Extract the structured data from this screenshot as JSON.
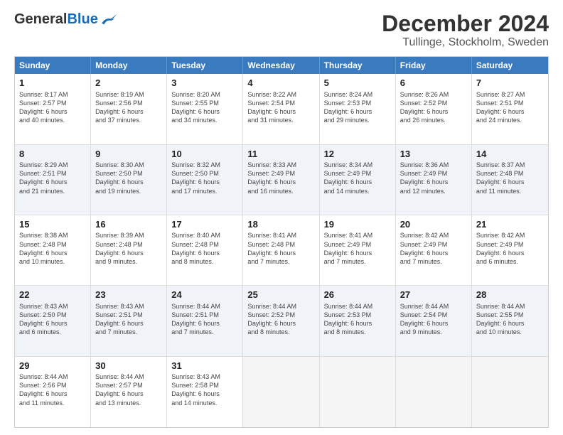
{
  "header": {
    "logo_general": "General",
    "logo_blue": "Blue",
    "title": "December 2024",
    "subtitle": "Tullinge, Stockholm, Sweden"
  },
  "weekdays": [
    "Sunday",
    "Monday",
    "Tuesday",
    "Wednesday",
    "Thursday",
    "Friday",
    "Saturday"
  ],
  "weeks": [
    [
      {
        "day": "1",
        "text": "Sunrise: 8:17 AM\nSunset: 2:57 PM\nDaylight: 6 hours\nand 40 minutes."
      },
      {
        "day": "2",
        "text": "Sunrise: 8:19 AM\nSunset: 2:56 PM\nDaylight: 6 hours\nand 37 minutes."
      },
      {
        "day": "3",
        "text": "Sunrise: 8:20 AM\nSunset: 2:55 PM\nDaylight: 6 hours\nand 34 minutes."
      },
      {
        "day": "4",
        "text": "Sunrise: 8:22 AM\nSunset: 2:54 PM\nDaylight: 6 hours\nand 31 minutes."
      },
      {
        "day": "5",
        "text": "Sunrise: 8:24 AM\nSunset: 2:53 PM\nDaylight: 6 hours\nand 29 minutes."
      },
      {
        "day": "6",
        "text": "Sunrise: 8:26 AM\nSunset: 2:52 PM\nDaylight: 6 hours\nand 26 minutes."
      },
      {
        "day": "7",
        "text": "Sunrise: 8:27 AM\nSunset: 2:51 PM\nDaylight: 6 hours\nand 24 minutes."
      }
    ],
    [
      {
        "day": "8",
        "text": "Sunrise: 8:29 AM\nSunset: 2:51 PM\nDaylight: 6 hours\nand 21 minutes."
      },
      {
        "day": "9",
        "text": "Sunrise: 8:30 AM\nSunset: 2:50 PM\nDaylight: 6 hours\nand 19 minutes."
      },
      {
        "day": "10",
        "text": "Sunrise: 8:32 AM\nSunset: 2:50 PM\nDaylight: 6 hours\nand 17 minutes."
      },
      {
        "day": "11",
        "text": "Sunrise: 8:33 AM\nSunset: 2:49 PM\nDaylight: 6 hours\nand 16 minutes."
      },
      {
        "day": "12",
        "text": "Sunrise: 8:34 AM\nSunset: 2:49 PM\nDaylight: 6 hours\nand 14 minutes."
      },
      {
        "day": "13",
        "text": "Sunrise: 8:36 AM\nSunset: 2:49 PM\nDaylight: 6 hours\nand 12 minutes."
      },
      {
        "day": "14",
        "text": "Sunrise: 8:37 AM\nSunset: 2:48 PM\nDaylight: 6 hours\nand 11 minutes."
      }
    ],
    [
      {
        "day": "15",
        "text": "Sunrise: 8:38 AM\nSunset: 2:48 PM\nDaylight: 6 hours\nand 10 minutes."
      },
      {
        "day": "16",
        "text": "Sunrise: 8:39 AM\nSunset: 2:48 PM\nDaylight: 6 hours\nand 9 minutes."
      },
      {
        "day": "17",
        "text": "Sunrise: 8:40 AM\nSunset: 2:48 PM\nDaylight: 6 hours\nand 8 minutes."
      },
      {
        "day": "18",
        "text": "Sunrise: 8:41 AM\nSunset: 2:48 PM\nDaylight: 6 hours\nand 7 minutes."
      },
      {
        "day": "19",
        "text": "Sunrise: 8:41 AM\nSunset: 2:49 PM\nDaylight: 6 hours\nand 7 minutes."
      },
      {
        "day": "20",
        "text": "Sunrise: 8:42 AM\nSunset: 2:49 PM\nDaylight: 6 hours\nand 7 minutes."
      },
      {
        "day": "21",
        "text": "Sunrise: 8:42 AM\nSunset: 2:49 PM\nDaylight: 6 hours\nand 6 minutes."
      }
    ],
    [
      {
        "day": "22",
        "text": "Sunrise: 8:43 AM\nSunset: 2:50 PM\nDaylight: 6 hours\nand 6 minutes."
      },
      {
        "day": "23",
        "text": "Sunrise: 8:43 AM\nSunset: 2:51 PM\nDaylight: 6 hours\nand 7 minutes."
      },
      {
        "day": "24",
        "text": "Sunrise: 8:44 AM\nSunset: 2:51 PM\nDaylight: 6 hours\nand 7 minutes."
      },
      {
        "day": "25",
        "text": "Sunrise: 8:44 AM\nSunset: 2:52 PM\nDaylight: 6 hours\nand 8 minutes."
      },
      {
        "day": "26",
        "text": "Sunrise: 8:44 AM\nSunset: 2:53 PM\nDaylight: 6 hours\nand 8 minutes."
      },
      {
        "day": "27",
        "text": "Sunrise: 8:44 AM\nSunset: 2:54 PM\nDaylight: 6 hours\nand 9 minutes."
      },
      {
        "day": "28",
        "text": "Sunrise: 8:44 AM\nSunset: 2:55 PM\nDaylight: 6 hours\nand 10 minutes."
      }
    ],
    [
      {
        "day": "29",
        "text": "Sunrise: 8:44 AM\nSunset: 2:56 PM\nDaylight: 6 hours\nand 11 minutes."
      },
      {
        "day": "30",
        "text": "Sunrise: 8:44 AM\nSunset: 2:57 PM\nDaylight: 6 hours\nand 13 minutes."
      },
      {
        "day": "31",
        "text": "Sunrise: 8:43 AM\nSunset: 2:58 PM\nDaylight: 6 hours\nand 14 minutes."
      },
      {
        "day": "",
        "text": ""
      },
      {
        "day": "",
        "text": ""
      },
      {
        "day": "",
        "text": ""
      },
      {
        "day": "",
        "text": ""
      }
    ]
  ]
}
